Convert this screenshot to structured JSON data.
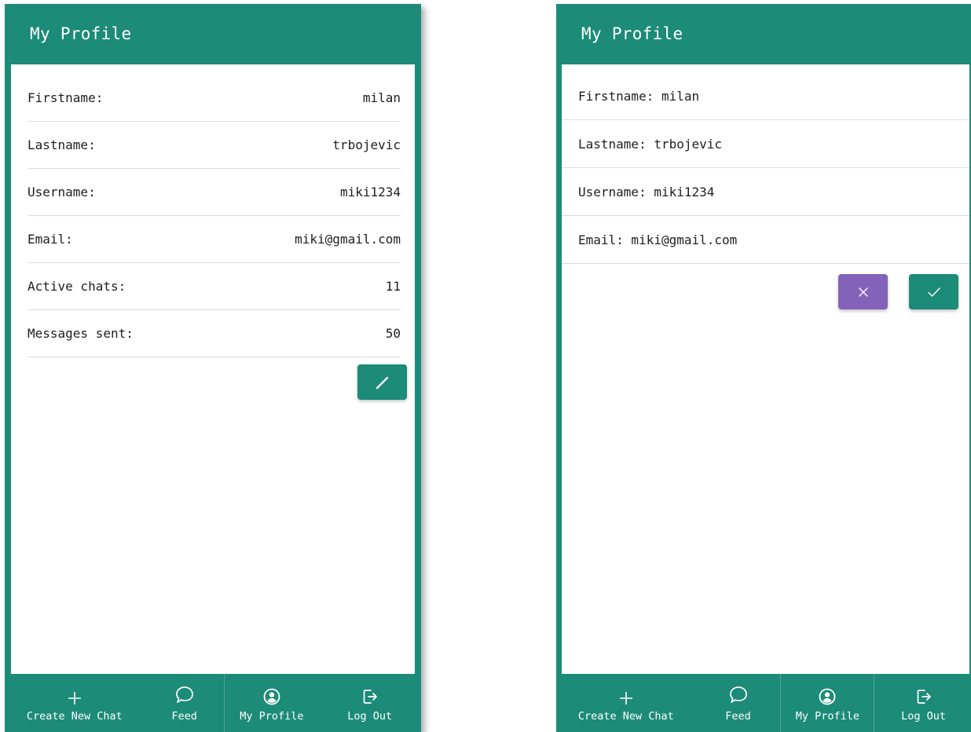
{
  "left": {
    "title": "My Profile",
    "fields": [
      {
        "label": "Firstname:",
        "value": "milan"
      },
      {
        "label": "Lastname:",
        "value": "trbojevic"
      },
      {
        "label": "Username:",
        "value": "miki1234"
      },
      {
        "label": "Email:",
        "value": "miki@gmail.com"
      },
      {
        "label": "Active chats:",
        "value": "11"
      },
      {
        "label": "Messages sent:",
        "value": "50"
      }
    ],
    "edit_icon": "pencil-icon"
  },
  "right": {
    "title": "My Profile",
    "fields": [
      {
        "text": "Firstname: milan"
      },
      {
        "text": "Lastname: trbojevic"
      },
      {
        "text": "Username: miki1234"
      },
      {
        "text": "Email: miki@gmail.com"
      }
    ],
    "cancel_icon": "close-icon",
    "confirm_icon": "check-icon"
  },
  "nav": [
    {
      "label": "Create New Chat",
      "icon": "plus-icon"
    },
    {
      "label": "Feed",
      "icon": "chat-bubble-icon"
    },
    {
      "label": "My Profile",
      "icon": "user-circle-icon"
    },
    {
      "label": "Log Out",
      "icon": "logout-icon"
    }
  ],
  "colors": {
    "primary": "#1c8b77",
    "cancel": "#8263b9",
    "surface": "#ffffff"
  }
}
